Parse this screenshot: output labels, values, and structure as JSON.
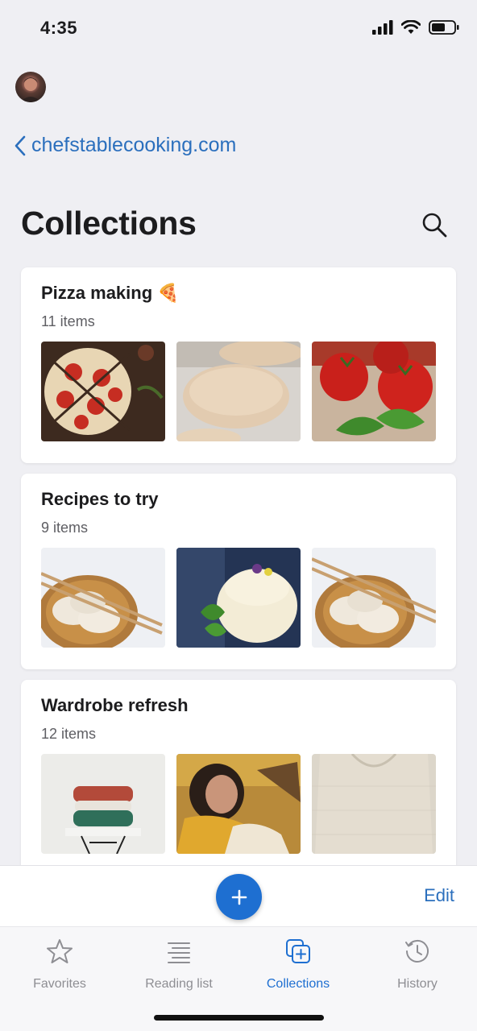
{
  "status_bar": {
    "time": "4:35"
  },
  "nav": {
    "back_label": "chefstablecooking.com"
  },
  "page": {
    "title": "Collections"
  },
  "collections": [
    {
      "title": "Pizza making 🍕",
      "count": "11 items",
      "thumbs": [
        "pizza-slices",
        "pizza-dough",
        "tomatoes-basil"
      ]
    },
    {
      "title": "Recipes to try",
      "count": "9 items",
      "thumbs": [
        "dumplings",
        "panna-cotta",
        "dumplings"
      ]
    },
    {
      "title": "Wardrobe refresh",
      "count": "12 items",
      "thumbs": [
        "folded-sweaters",
        "person-yellow-jacket",
        "knit-sweater"
      ]
    }
  ],
  "toolbar": {
    "add_icon": "plus-icon",
    "edit_label": "Edit"
  },
  "tabs": [
    {
      "label": "Favorites",
      "icon": "star-icon",
      "active": false
    },
    {
      "label": "Reading list",
      "icon": "reading-list-icon",
      "active": false
    },
    {
      "label": "Collections",
      "icon": "collections-icon",
      "active": true
    },
    {
      "label": "History",
      "icon": "history-icon",
      "active": false
    }
  ],
  "colors": {
    "accent": "#1e6fd1",
    "link": "#2b6fbd",
    "background": "#efeff3",
    "inactive_tab": "#8e8e93"
  }
}
